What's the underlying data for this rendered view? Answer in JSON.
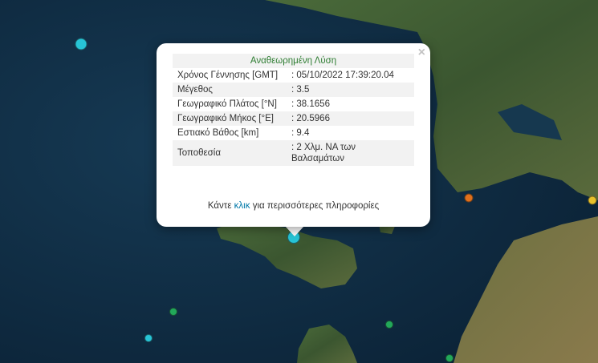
{
  "popup": {
    "title": "Αναθεωρημένη Λύση",
    "close_icon": "×",
    "rows": [
      {
        "label": "Χρόνος Γέννησης [GMT]",
        "value": ": 05/10/2022 17:39:20.04"
      },
      {
        "label": "Μέγεθος",
        "value": ": 3.5"
      },
      {
        "label": "Γεωγραφικό Πλάτος [°N]",
        "value": ": 38.1656"
      },
      {
        "label": "Γεωγραφικό Μήκος [°E]",
        "value": ": 20.5966"
      },
      {
        "label": "Εστιακό Βάθος [km]",
        "value": ": 9.4"
      },
      {
        "label": "Τοποθεσία",
        "value": ": 2 Χλμ. ΝΑ των Βαλσαμάτων"
      }
    ],
    "more_prefix": "Κάντε",
    "more_link": "κλικ",
    "more_suffix": "για περισσότερες πληροφορίες"
  },
  "markers": [
    {
      "name": "marker-cyan-large",
      "color": "#27c4d6",
      "size": "large"
    },
    {
      "name": "marker-selected",
      "color": "#27c4d6",
      "size": "large"
    },
    {
      "name": "marker-cyan-small",
      "color": "#27c4d6",
      "size": "small"
    },
    {
      "name": "marker-green-1",
      "color": "#22a85a",
      "size": "small"
    },
    {
      "name": "marker-green-2",
      "color": "#22a85a",
      "size": "small"
    },
    {
      "name": "marker-green-3",
      "color": "#22a85a",
      "size": "small"
    },
    {
      "name": "marker-orange",
      "color": "#e0701c",
      "size": "small"
    },
    {
      "name": "marker-yellow",
      "color": "#e8c02a",
      "size": "small"
    }
  ],
  "colors": {
    "sea": "#0e2a40",
    "land": "#3d5a30",
    "title_green": "#2e7d32",
    "link": "#0078a8"
  }
}
